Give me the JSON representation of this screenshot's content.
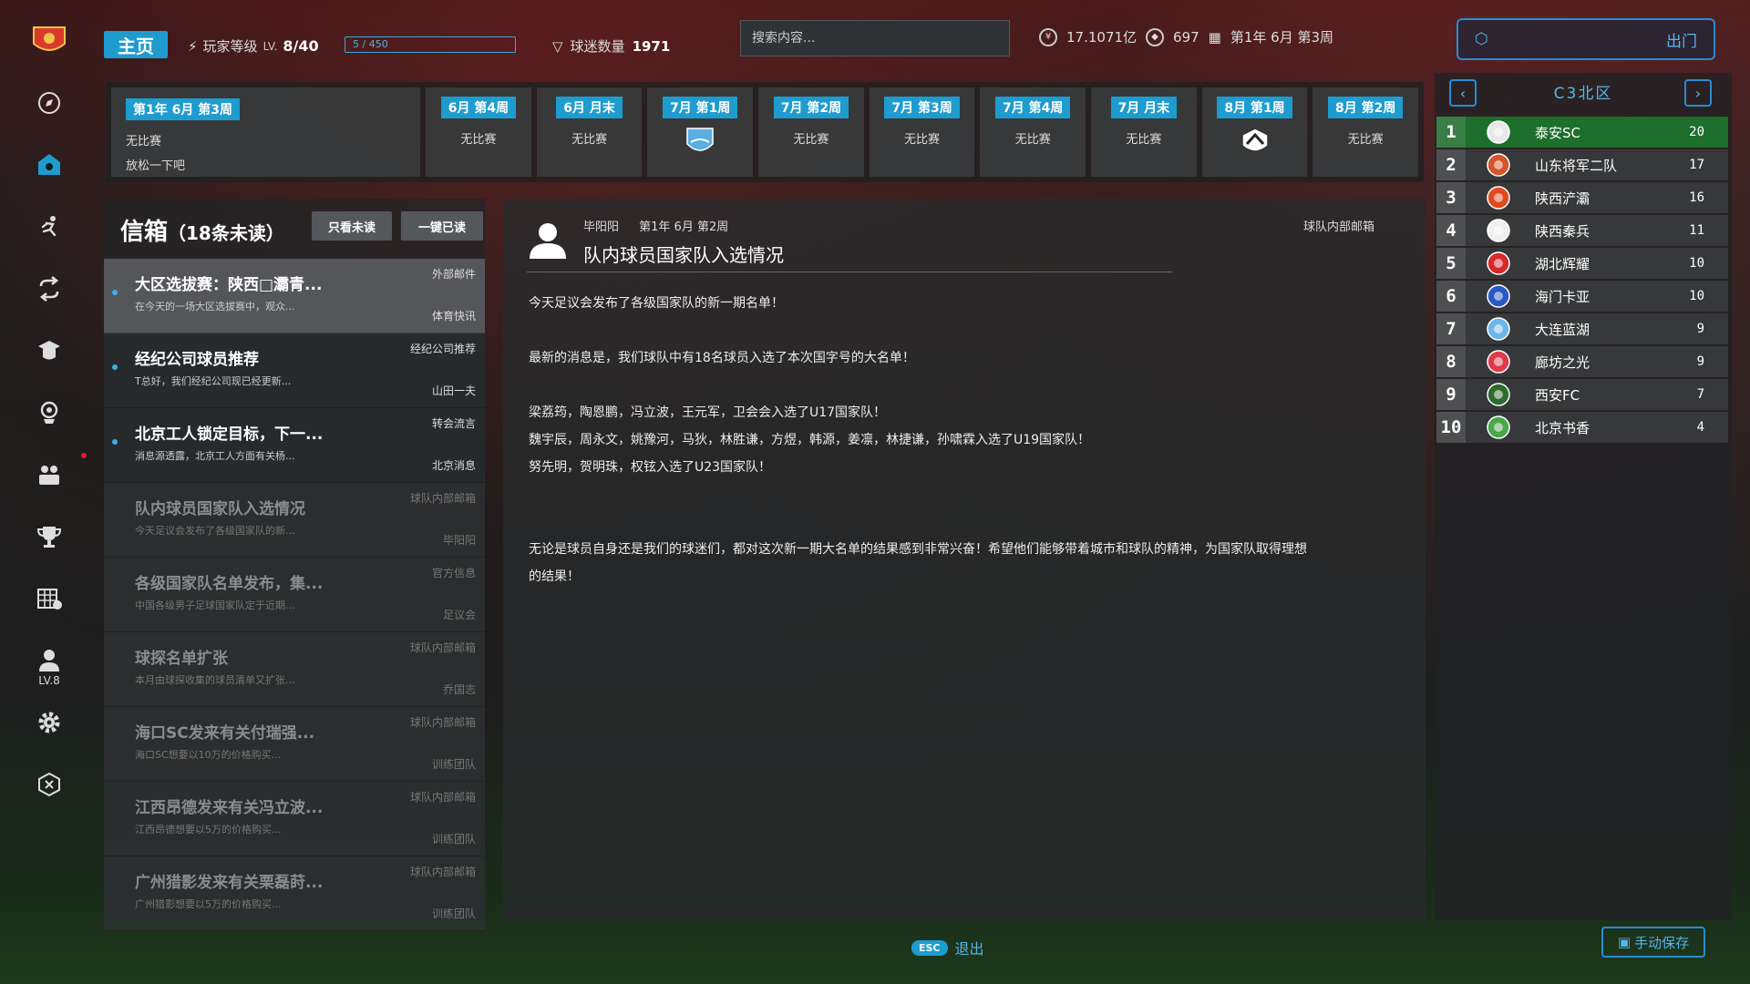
{
  "topbar": {
    "home_label": "主页",
    "player_level_label": "玩家等级",
    "lv_prefix": "LV.",
    "level_value": "8/40",
    "xp_text": "5 / 450",
    "fans_label": "球迷数量",
    "fans_value": "1971",
    "search_placeholder": "搜索内容...",
    "money": "17.1071亿",
    "coins": "697",
    "date": "第1年 6月 第3周",
    "exit_label": "出门"
  },
  "sidebar": {
    "level_label": "LV.8"
  },
  "schedule": {
    "current": {
      "tag": "第1年 6月 第3周",
      "line1": "无比赛",
      "line2": "放松一下吧"
    },
    "items": [
      {
        "tag": "6月 第4周",
        "text": "无比赛"
      },
      {
        "tag": "6月 月末",
        "text": "无比赛"
      },
      {
        "tag": "7月 第1周",
        "text": "",
        "badge": "badge-blue-shield"
      },
      {
        "tag": "7月 第2周",
        "text": "无比赛"
      },
      {
        "tag": "7月 第3周",
        "text": "无比赛"
      },
      {
        "tag": "7月 第4周",
        "text": "无比赛"
      },
      {
        "tag": "7月 月末",
        "text": "无比赛"
      },
      {
        "tag": "8月 第1周",
        "text": "",
        "badge": "badge-black-white"
      },
      {
        "tag": "8月 第2周",
        "text": "无比赛"
      }
    ]
  },
  "mailbox": {
    "title": "信箱",
    "unread_count": "（18条未读）",
    "filter_unread_label": "只看未读",
    "mark_all_read_label": "一键已读",
    "mails": [
      {
        "subject": "大区选拔赛：陕西□灞青...",
        "preview": "在今天的一场大区选拔赛中，观众...",
        "category": "外部邮件",
        "sender": "体育快讯",
        "state": "selected"
      },
      {
        "subject": "经纪公司球员推荐",
        "preview": "T总好，我们经纪公司现已经更新...",
        "category": "经纪公司推荐",
        "sender": "山田一夫",
        "state": "unread"
      },
      {
        "subject": "北京工人锁定目标，下一...",
        "preview": "消息源透露，北京工人方面有关杨...",
        "category": "转会流言",
        "sender": "北京消息",
        "state": "unread"
      },
      {
        "subject": "队内球员国家队入选情况",
        "preview": "今天足议会发布了各级国家队的新...",
        "category": "球队内部邮箱",
        "sender": "毕阳阳",
        "state": "read"
      },
      {
        "subject": "各级国家队名单发布，集...",
        "preview": "中国各级男子足球国家队定于近期...",
        "category": "官方信息",
        "sender": "足议会",
        "state": "read"
      },
      {
        "subject": "球探名单扩张",
        "preview": "本月由球探收集的球员清单又扩张...",
        "category": "球队内部邮箱",
        "sender": "乔国志",
        "state": "read"
      },
      {
        "subject": "海口SC发来有关付瑞强...",
        "preview": "海口SC想要以10万的价格购买...",
        "category": "球队内部邮箱",
        "sender": "训练团队",
        "state": "read"
      },
      {
        "subject": "江西昂德发来有关冯立波...",
        "preview": "江西昂德想要以5万的价格购买...",
        "category": "球队内部邮箱",
        "sender": "训练团队",
        "state": "read"
      },
      {
        "subject": "广州猎影发来有关栗磊莳...",
        "preview": "广州猎影想要以5万的价格购买...",
        "category": "球队内部邮箱",
        "sender": "训练团队",
        "state": "read"
      }
    ]
  },
  "mail_content": {
    "sender": "毕阳阳",
    "date": "第1年 6月 第2周",
    "title": "队内球员国家队入选情况",
    "box": "球队内部邮箱",
    "p1": "今天足议会发布了各级国家队的新一期名单！",
    "p2": "最新的消息是，我们球队中有18名球员入选了本次国字号的大名单！",
    "p3": "梁荔筠，陶恩鹏，冯立波，王元军，卫会会入选了U17国家队！",
    "p4": "魏宇辰，周永文，姚豫河，马狄，林胜谦，方煜，韩源，姜凛，林捷谦，孙啸霖入选了U19国家队！",
    "p5": "努先明，贺明珠，权铉入选了U23国家队！",
    "p6": "无论是球员自身还是我们的球迷们，都对这次新一期大名单的结果感到非常兴奋！希望他们能够带着城市和球队的精神，为国家队取得理想",
    "p7": "的结果！"
  },
  "league": {
    "title": "C3北区",
    "rows": [
      {
        "rank": "1",
        "name": "泰安SC",
        "pts": "20",
        "color": "#e8e8e8"
      },
      {
        "rank": "2",
        "name": "山东将军二队",
        "pts": "17",
        "color": "#d4562a"
      },
      {
        "rank": "3",
        "name": "陕西浐灞",
        "pts": "16",
        "color": "#e04a1e"
      },
      {
        "rank": "4",
        "name": "陕西秦兵",
        "pts": "11",
        "color": "#f0f0f0"
      },
      {
        "rank": "5",
        "name": "湖北辉耀",
        "pts": "10",
        "color": "#d62a2a"
      },
      {
        "rank": "6",
        "name": "海门卡亚",
        "pts": "10",
        "color": "#2a58c8"
      },
      {
        "rank": "7",
        "name": "大连蓝湖",
        "pts": "9",
        "color": "#6fb6e8"
      },
      {
        "rank": "8",
        "name": "廊坊之光",
        "pts": "9",
        "color": "#e03a4a"
      },
      {
        "rank": "9",
        "name": "西安FC",
        "pts": "7",
        "color": "#2f6a2f"
      },
      {
        "rank": "10",
        "name": "北京书香",
        "pts": "4",
        "color": "#48a84a"
      }
    ]
  },
  "footer": {
    "esc_key": "ESC",
    "esc_label": "退出",
    "save_label": "手动保存"
  },
  "colors": {
    "accent": "#1e9ccf",
    "accent_light": "#56b5ea",
    "leader_row": "#1e6e2c"
  }
}
